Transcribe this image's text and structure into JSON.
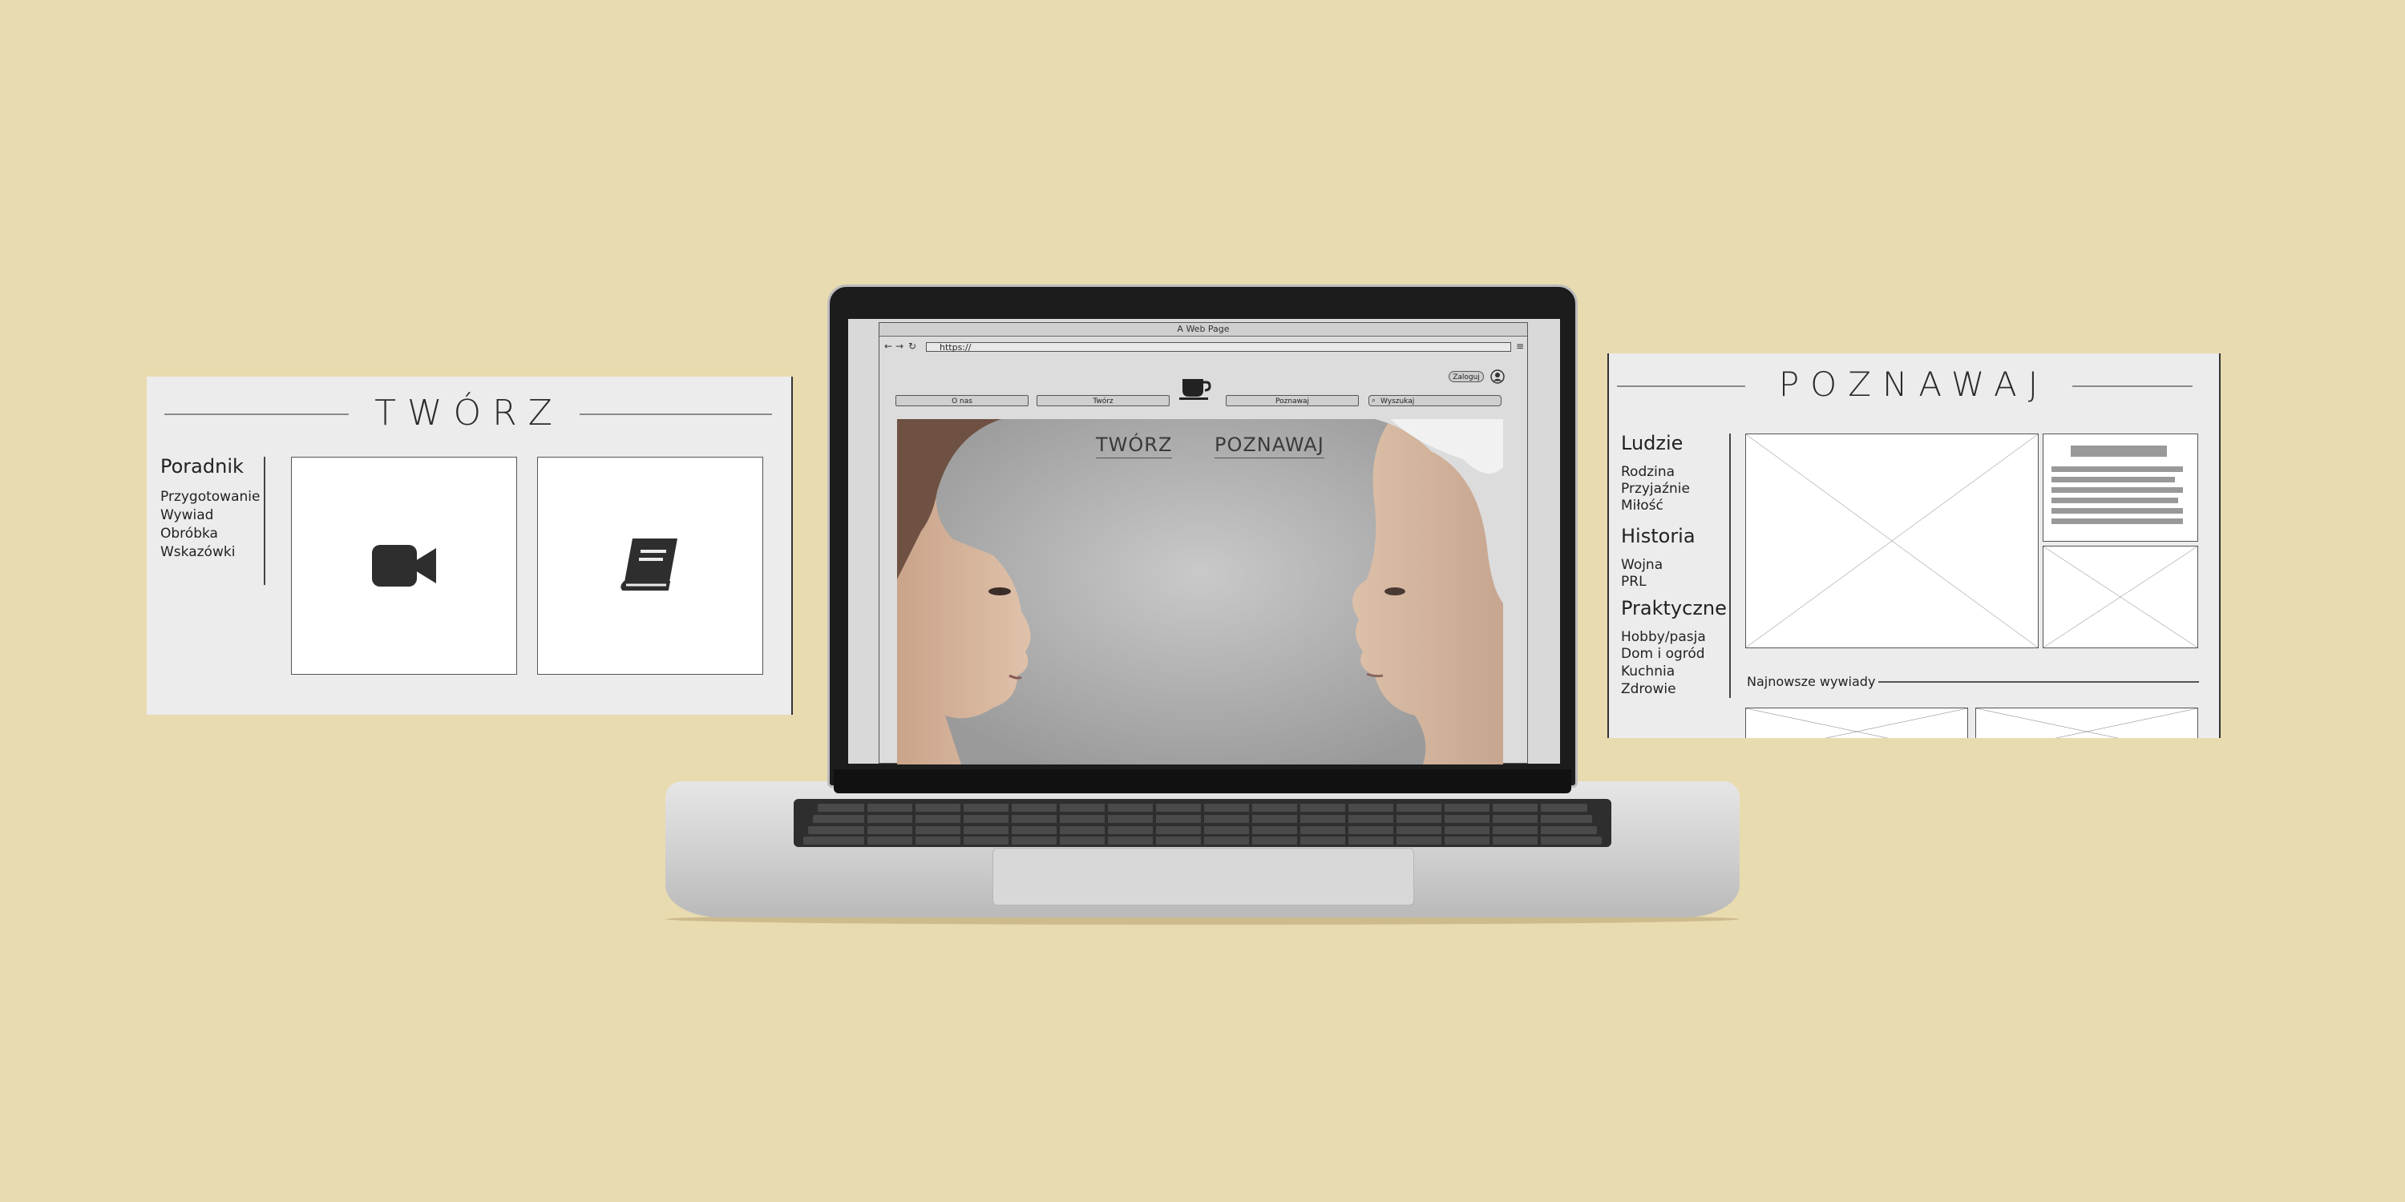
{
  "left_panel": {
    "title": "TWÓRZ",
    "section_heading": "Poradnik",
    "items": [
      "Przygotowanie",
      "Wywiad",
      "Obróbka",
      "Wskazówki"
    ],
    "cards": [
      {
        "icon": "video-camera-icon"
      },
      {
        "icon": "book-icon"
      }
    ]
  },
  "right_panel": {
    "title": "POZNAWAJ",
    "categories": [
      {
        "heading": "Ludzie",
        "items": [
          "Rodzina",
          "Przyjaźnie",
          "Miłość"
        ]
      },
      {
        "heading": "Historia",
        "items": [
          "Wojna",
          "PRL"
        ]
      },
      {
        "heading": "Praktyczne",
        "items": [
          "Hobby/pasja",
          "Dom i ogród",
          "Kuchnia",
          "Zdrowie"
        ]
      }
    ],
    "latest_label": "Najnowsze wywiady"
  },
  "laptop_screen": {
    "window_title": "A Web Page",
    "url": "https://",
    "login_label": "Zaloguj",
    "nav": [
      "O nas",
      "Twórz",
      "Poznawaj"
    ],
    "search_placeholder": "Wyszukaj",
    "logo_icon": "coffee-cup-icon",
    "hero_links": [
      "TWÓRZ",
      "POZNAWAJ"
    ]
  },
  "colors": {
    "background": "#e9dbb0",
    "panel": "#ececec",
    "icon": "#2e2e2e"
  }
}
